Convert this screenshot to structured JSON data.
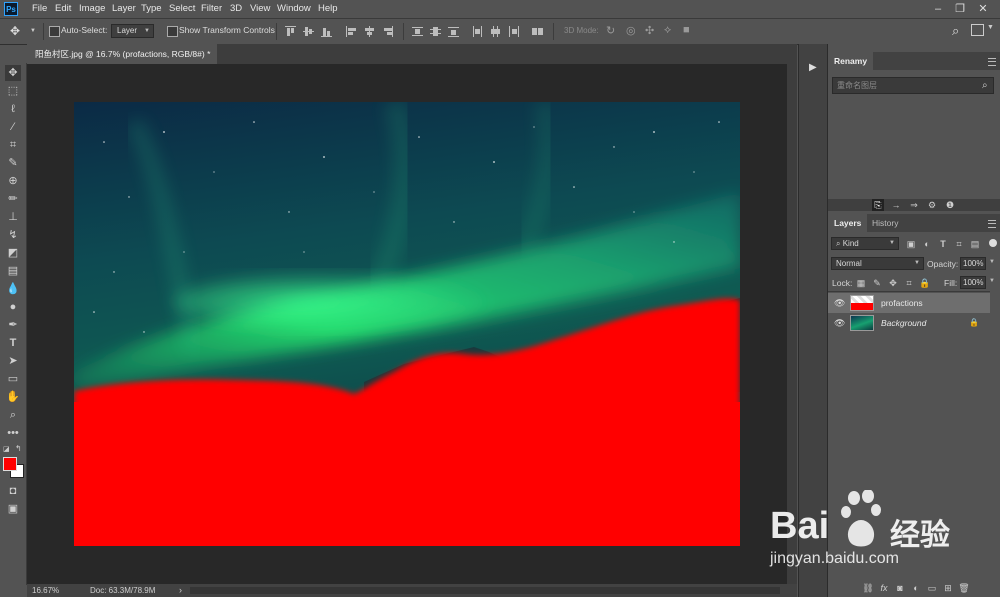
{
  "app": {
    "logo_text": "Ps"
  },
  "menu": [
    "File",
    "Edit",
    "Image",
    "Layer",
    "Type",
    "Select",
    "Filter",
    "3D",
    "View",
    "Window",
    "Help"
  ],
  "options_bar": {
    "auto_select_label": "Auto-Select:",
    "auto_select_target": "Layer",
    "show_transform_label": "Show Transform Controls",
    "mode_3d_label": "3D Mode:"
  },
  "document": {
    "tab_title": "阳鱼村区.jpg @ 16.7% (profactions, RGB/8#) *",
    "close_glyph": "×",
    "zoom": "16.67%",
    "doc_size": "Doc: 63.3M/78.9M"
  },
  "colors": {
    "foreground": "#ff0000",
    "background": "#ffffff",
    "mask_red": "#ff0000",
    "accent": "#31a8ff"
  },
  "renamy_panel": {
    "title": "Renamy",
    "search_placeholder": "重命名图层"
  },
  "layers_panel": {
    "tabs": [
      "Layers",
      "History"
    ],
    "filter_kind": "Kind",
    "blend_mode": "Normal",
    "opacity_label": "Opacity:",
    "opacity_value": "100%",
    "lock_label": "Lock:",
    "fill_label": "Fill:",
    "fill_value": "100%",
    "layers": [
      {
        "name": "profactions",
        "selected": true
      },
      {
        "name": "Background",
        "locked": true,
        "italic": true
      }
    ]
  },
  "watermark": {
    "brand": "Bai",
    "brand_cn": "经验",
    "url": "jingyan.baidu.com"
  },
  "icons": [
    "move-tool-icon",
    "marquee-tool-icon",
    "lasso-tool-icon",
    "magic-wand-icon",
    "crop-tool-icon",
    "eyedropper-icon",
    "healing-brush-icon",
    "brush-tool-icon",
    "clone-stamp-icon",
    "history-brush-icon",
    "eraser-icon",
    "gradient-icon",
    "blur-icon",
    "dodge-icon",
    "pen-icon",
    "type-icon",
    "path-select-icon",
    "shape-icon",
    "hand-icon",
    "zoom-icon",
    "more-tools-icon",
    "search-icon",
    "workspace-icon",
    "share-icon",
    "eye-icon",
    "lock-icon"
  ]
}
